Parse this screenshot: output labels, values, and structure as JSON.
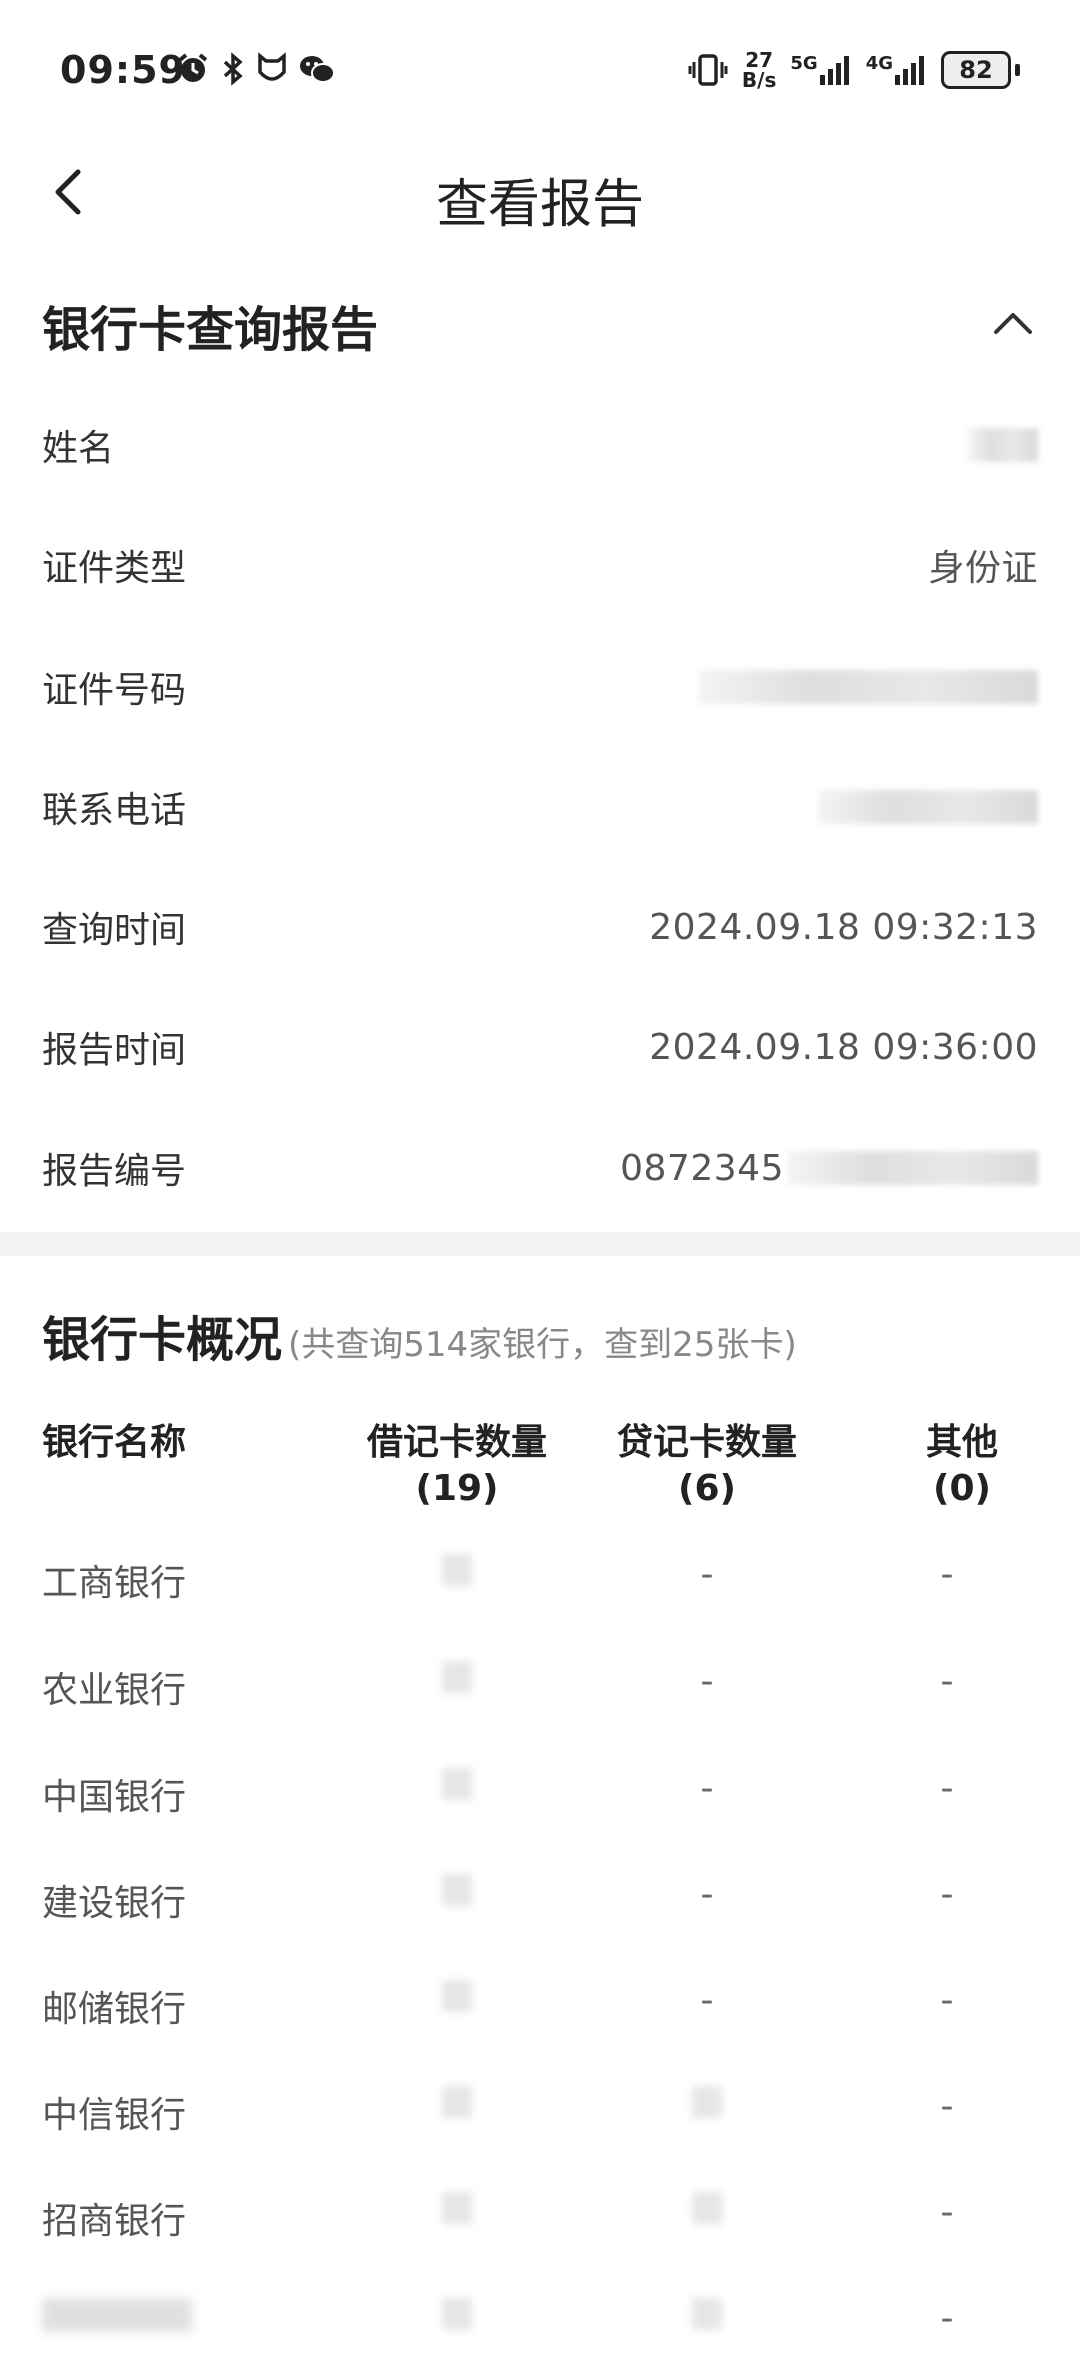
{
  "status_bar": {
    "time": "09:59",
    "net_speed_top": "27",
    "net_speed_bottom": "B/s",
    "net1": "5G",
    "net2": "4G",
    "battery": "82",
    "icons": [
      "alarm-icon",
      "bluetooth-icon",
      "mi-icon",
      "wechat-icon",
      "vibrate-icon",
      "signal-icon",
      "signal-icon"
    ]
  },
  "nav": {
    "title": "查看报告",
    "back_icon": "chevron-left-icon"
  },
  "report": {
    "title": "银行卡查询报告",
    "collapse_icon": "chevron-up-icon",
    "rows": [
      {
        "label": "姓名",
        "value": ""
      },
      {
        "label": "证件类型",
        "value": "身份证"
      },
      {
        "label": "证件号码",
        "value": ""
      },
      {
        "label": "联系电话",
        "value": ""
      },
      {
        "label": "查询时间",
        "value": "2024.09.18 09:32:13"
      },
      {
        "label": "报告时间",
        "value": "2024.09.18 09:36:00"
      },
      {
        "label": "报告编号",
        "value": "0872345"
      }
    ]
  },
  "overview": {
    "title": "银行卡概况",
    "subtitle": "(共查询514家银行，查到25张卡)",
    "columns": {
      "bank": "银行名称",
      "debit": "借记卡数量",
      "debit_count": "(19)",
      "credit": "贷记卡数量",
      "credit_count": "(6)",
      "other": "其他",
      "other_count": "(0)"
    },
    "rows": [
      {
        "bank": "工商银行",
        "debit": "",
        "credit": "-",
        "other": "-"
      },
      {
        "bank": "农业银行",
        "debit": "",
        "credit": "-",
        "other": "-"
      },
      {
        "bank": "中国银行",
        "debit": "",
        "credit": "-",
        "other": "-"
      },
      {
        "bank": "建设银行",
        "debit": "",
        "credit": "-",
        "other": "-"
      },
      {
        "bank": "邮储银行",
        "debit": "",
        "credit": "-",
        "other": "-"
      },
      {
        "bank": "中信银行",
        "debit": "",
        "credit": "",
        "other": "-"
      },
      {
        "bank": "招商银行",
        "debit": "",
        "credit": "",
        "other": "-"
      },
      {
        "bank": "",
        "debit": "",
        "credit": "",
        "other": "-"
      }
    ]
  }
}
